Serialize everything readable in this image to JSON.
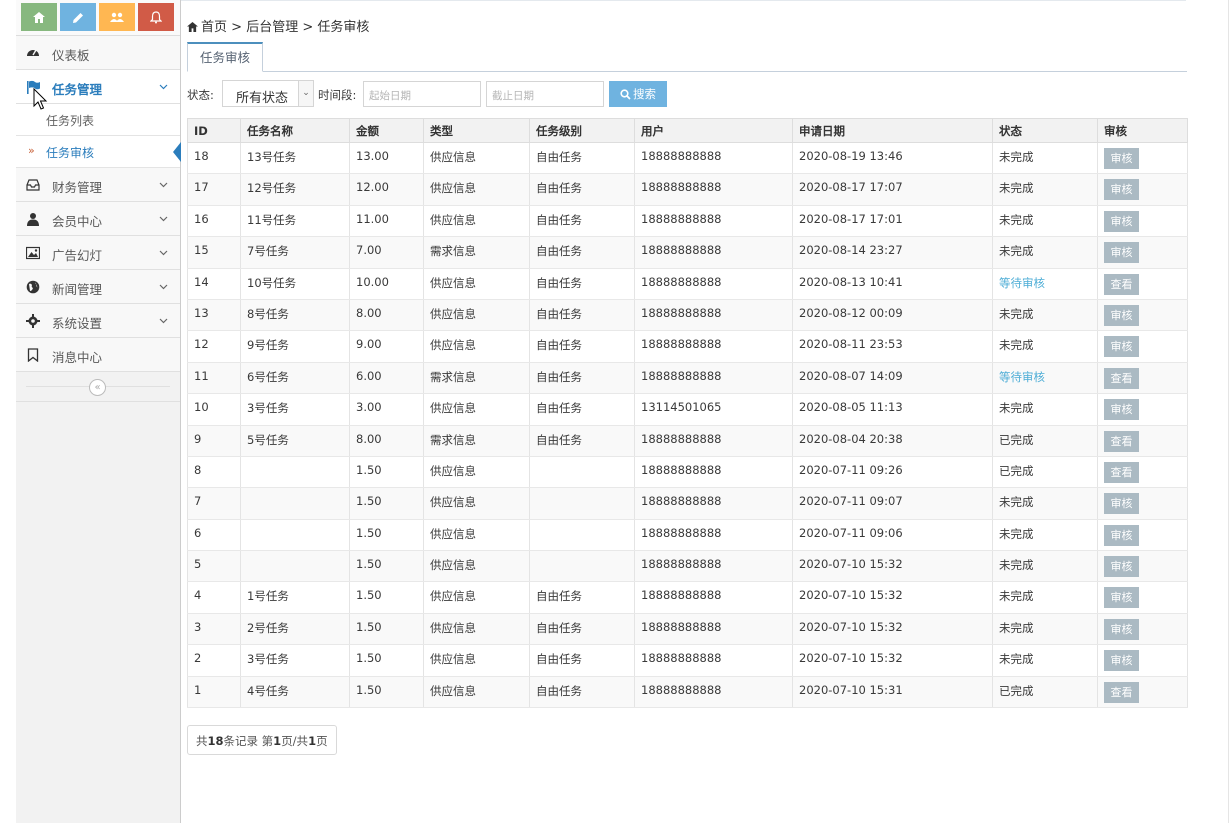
{
  "sidebar": {
    "shortcuts": [
      {
        "icon": "home-icon",
        "color": "#87b87f"
      },
      {
        "icon": "pencil-icon",
        "color": "#6fb3e0"
      },
      {
        "icon": "users-icon",
        "color": "#ffb752"
      },
      {
        "icon": "bell-icon",
        "color": "#d15b47"
      }
    ],
    "items": [
      {
        "label": "仪表板",
        "icon": "dashboard-icon"
      },
      {
        "label": "任务管理",
        "icon": "flag-icon"
      },
      {
        "label": "财务管理",
        "icon": "inbox-icon"
      },
      {
        "label": "会员中心",
        "icon": "user-icon"
      },
      {
        "label": "广告幻灯",
        "icon": "picture-icon"
      },
      {
        "label": "新闻管理",
        "icon": "globe-icon"
      },
      {
        "label": "系统设置",
        "icon": "cog-icon"
      },
      {
        "label": "消息中心",
        "icon": "bookmark-icon"
      }
    ],
    "sub": [
      {
        "label": "任务列表"
      },
      {
        "label": "任务审核"
      }
    ],
    "collapse": "«"
  },
  "breadcrumb": {
    "home": "首页",
    "sep1": " > ",
    "part2": "后台管理",
    "sep2": " > ",
    "part3": "任务审核"
  },
  "tab": {
    "label": "任务审核"
  },
  "filter": {
    "status_label": "状态:",
    "status_value": "所有状态",
    "time_label": "时间段:",
    "start_placeholder": "起始日期",
    "end_placeholder": "截止日期",
    "search_label": "搜索"
  },
  "table": {
    "headers": [
      "ID",
      "任务名称",
      "金额",
      "类型",
      "任务级别",
      "用户",
      "申请日期",
      "状态",
      "审核"
    ],
    "rows": [
      [
        "18",
        "13号任务",
        "13.00",
        "供应信息",
        "自由任务",
        "18888888888",
        "2020-08-19 13:46",
        "未完成",
        "审核"
      ],
      [
        "17",
        "12号任务",
        "12.00",
        "供应信息",
        "自由任务",
        "18888888888",
        "2020-08-17 17:07",
        "未完成",
        "审核"
      ],
      [
        "16",
        "11号任务",
        "11.00",
        "供应信息",
        "自由任务",
        "18888888888",
        "2020-08-17 17:01",
        "未完成",
        "审核"
      ],
      [
        "15",
        "7号任务",
        "7.00",
        "需求信息",
        "自由任务",
        "18888888888",
        "2020-08-14 23:27",
        "未完成",
        "审核"
      ],
      [
        "14",
        "10号任务",
        "10.00",
        "供应信息",
        "自由任务",
        "18888888888",
        "2020-08-13 10:41",
        "等待审核",
        "查看"
      ],
      [
        "13",
        "8号任务",
        "8.00",
        "供应信息",
        "自由任务",
        "18888888888",
        "2020-08-12 00:09",
        "未完成",
        "审核"
      ],
      [
        "12",
        "9号任务",
        "9.00",
        "供应信息",
        "自由任务",
        "18888888888",
        "2020-08-11 23:53",
        "未完成",
        "审核"
      ],
      [
        "11",
        "6号任务",
        "6.00",
        "需求信息",
        "自由任务",
        "18888888888",
        "2020-08-07 14:09",
        "等待审核",
        "查看"
      ],
      [
        "10",
        "3号任务",
        "3.00",
        "供应信息",
        "自由任务",
        "13114501065",
        "2020-08-05 11:13",
        "未完成",
        "审核"
      ],
      [
        "9",
        "5号任务",
        "8.00",
        "需求信息",
        "自由任务",
        "18888888888",
        "2020-08-04 20:38",
        "已完成",
        "查看"
      ],
      [
        "8",
        "",
        "1.50",
        "供应信息",
        "",
        "18888888888",
        "2020-07-11 09:26",
        "已完成",
        "查看"
      ],
      [
        "7",
        "",
        "1.50",
        "供应信息",
        "",
        "18888888888",
        "2020-07-11 09:07",
        "未完成",
        "审核"
      ],
      [
        "6",
        "",
        "1.50",
        "供应信息",
        "",
        "18888888888",
        "2020-07-11 09:06",
        "未完成",
        "审核"
      ],
      [
        "5",
        "",
        "1.50",
        "供应信息",
        "",
        "18888888888",
        "2020-07-10 15:32",
        "未完成",
        "审核"
      ],
      [
        "4",
        "1号任务",
        "1.50",
        "供应信息",
        "自由任务",
        "18888888888",
        "2020-07-10 15:32",
        "未完成",
        "审核"
      ],
      [
        "3",
        "2号任务",
        "1.50",
        "供应信息",
        "自由任务",
        "18888888888",
        "2020-07-10 15:32",
        "未完成",
        "审核"
      ],
      [
        "2",
        "3号任务",
        "1.50",
        "供应信息",
        "自由任务",
        "18888888888",
        "2020-07-10 15:32",
        "未完成",
        "审核"
      ],
      [
        "1",
        "4号任务",
        "1.50",
        "供应信息",
        "自由任务",
        "18888888888",
        "2020-07-10 15:31",
        "已完成",
        "查看"
      ]
    ]
  },
  "pager": {
    "p1": "共",
    "total": "18",
    "p2": "条记录 第",
    "page": "1",
    "p3": "页/共",
    "pages": "1",
    "p4": "页"
  },
  "colors": {
    "accent": "#2b7dbc",
    "waiting": "#4dadd6",
    "action_btn": "#abbac3",
    "search_btn": "#6fb3e0"
  }
}
